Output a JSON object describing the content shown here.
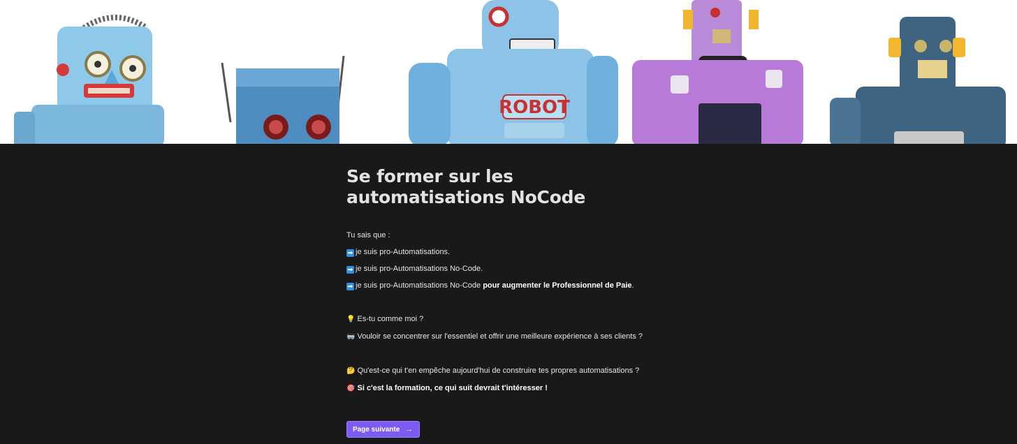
{
  "banner": {
    "robot_text": "ROBOT"
  },
  "page": {
    "title": "Se former sur les automatisations NoCode",
    "intro": "Tu sais que :",
    "lines": [
      {
        "icon": "➡",
        "text": "je suis pro-Automatisations."
      },
      {
        "icon": "➡",
        "text": "je suis pro-Automatisations No-Code."
      },
      {
        "icon": "➡",
        "text": "je suis pro-Automatisations No-Code ",
        "bold": "pour augmenter le Professionnel de Paie",
        "tail": "."
      }
    ],
    "question1": {
      "icon": "💡",
      "text": "Es-tu comme moi ?"
    },
    "question2": {
      "icon": "🥽",
      "text": "Vouloir se concentrer sur l'essentiel et offrir une meilleure expérience à ses clients ?"
    },
    "question3": {
      "icon": "🤔",
      "text": "Qu'est-ce qui t'en empêche aujourd'hui de construire tes propres automatisations ?"
    },
    "question4": {
      "icon": "🎯",
      "text": "Si c'est la formation, ce qui suit devrait t'intéresser !"
    },
    "next_button": {
      "label": "Page suivante",
      "icon": "→"
    }
  },
  "colors": {
    "background": "#191919",
    "button": "#7b5bf2",
    "arrow_icon": "#2f8fe0"
  }
}
